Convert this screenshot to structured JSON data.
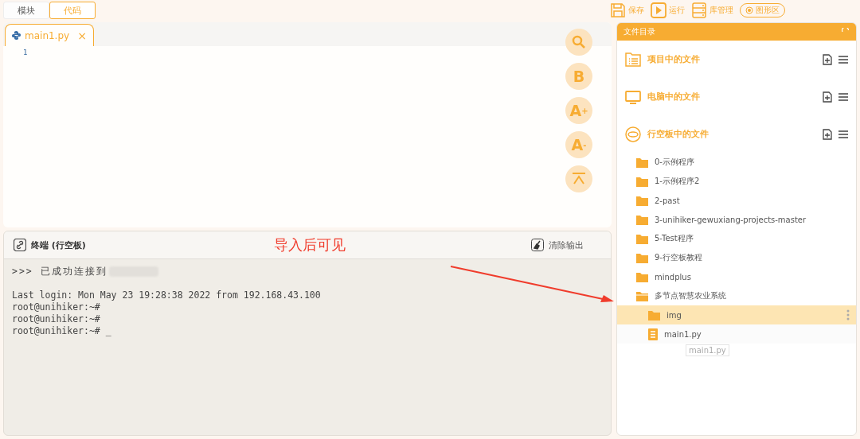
{
  "mode_tabs": [
    {
      "label": "模块",
      "selected": false
    },
    {
      "label": "代码",
      "selected": true
    }
  ],
  "toolbar": [
    {
      "kind": "save",
      "label": "保存"
    },
    {
      "kind": "run",
      "label": "运行"
    },
    {
      "kind": "library",
      "label": "库管理"
    },
    {
      "kind": "graphic",
      "label": "图形区"
    }
  ],
  "editor": {
    "tabs": [
      {
        "label": "main1.py",
        "selected": true,
        "close": "×"
      }
    ],
    "line_numbers": [
      "1"
    ],
    "tools": [
      {
        "kind": "search"
      },
      {
        "kind": "bold",
        "label": "B"
      },
      {
        "kind": "font-up",
        "label": "A",
        "sup": "+"
      },
      {
        "kind": "font-down",
        "label": "A",
        "sup": "-"
      },
      {
        "kind": "top"
      }
    ]
  },
  "terminal": {
    "title": "终端 (行空板)",
    "clear": "清除输出",
    "annotation": "导入后可见",
    "status": {
      "text": ">>> 已成功连接到",
      "redacted": true
    },
    "lines": [
      {
        "text": "Last login: Mon May 23 19:28:38 2022 from 192.168.43.100"
      },
      {
        "text": "root@unihiker:~#"
      },
      {
        "text": "root@unihiker:~#"
      },
      {
        "text": "root@unihiker:~# _"
      }
    ]
  },
  "file_panel": {
    "title": "文件目录",
    "sections": [
      {
        "kind": "project",
        "label": "项目中的文件"
      },
      {
        "kind": "computer",
        "label": "电脑中的文件"
      },
      {
        "kind": "board",
        "label": "行空板中的文件",
        "children": [
          {
            "kind": "folder",
            "label": "0-示例程序",
            "selected": false
          },
          {
            "kind": "folder",
            "label": "1-示例程序2",
            "selected": false
          },
          {
            "kind": "folder",
            "label": "2-past",
            "selected": false
          },
          {
            "kind": "folder",
            "label": "3-unihiker-gewuxiang-projects-master",
            "selected": false
          },
          {
            "kind": "folder",
            "label": "5-Test程序",
            "selected": false
          },
          {
            "kind": "folder",
            "label": "9-行空板教程",
            "selected": false
          },
          {
            "kind": "folder",
            "label": "mindplus",
            "selected": false
          },
          {
            "kind": "folder",
            "label": "多节点智慧农业系统",
            "selected": false,
            "children": [
              {
                "kind": "folder",
                "label": "img",
                "selected": true
              },
              {
                "kind": "file",
                "label": "main1.py",
                "selected": false
              }
            ]
          }
        ]
      }
    ],
    "drag_ghost": "main1.py"
  }
}
